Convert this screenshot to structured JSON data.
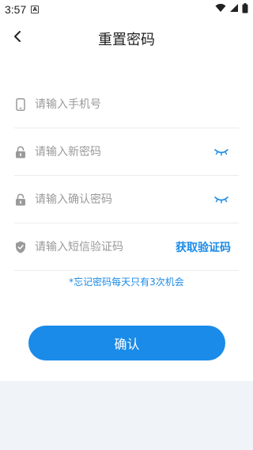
{
  "status_bar": {
    "time": "3:57",
    "notification_icon": "A",
    "icons": [
      "wifi-icon",
      "signal-icon",
      "battery-icon"
    ]
  },
  "header": {
    "title": "重置密码"
  },
  "form": {
    "phone_placeholder": "请输入手机号",
    "new_password_placeholder": "请输入新密码",
    "confirm_password_placeholder": "请输入确认密码",
    "sms_code_placeholder": "请输入短信验证码",
    "get_code_label": "获取验证码"
  },
  "note": "*忘记密码每天只有3次机会",
  "confirm_label": "确认",
  "colors": {
    "accent": "#1a8be8",
    "background": "#f0f3f8",
    "icon_gray": "#9a9a9a"
  }
}
